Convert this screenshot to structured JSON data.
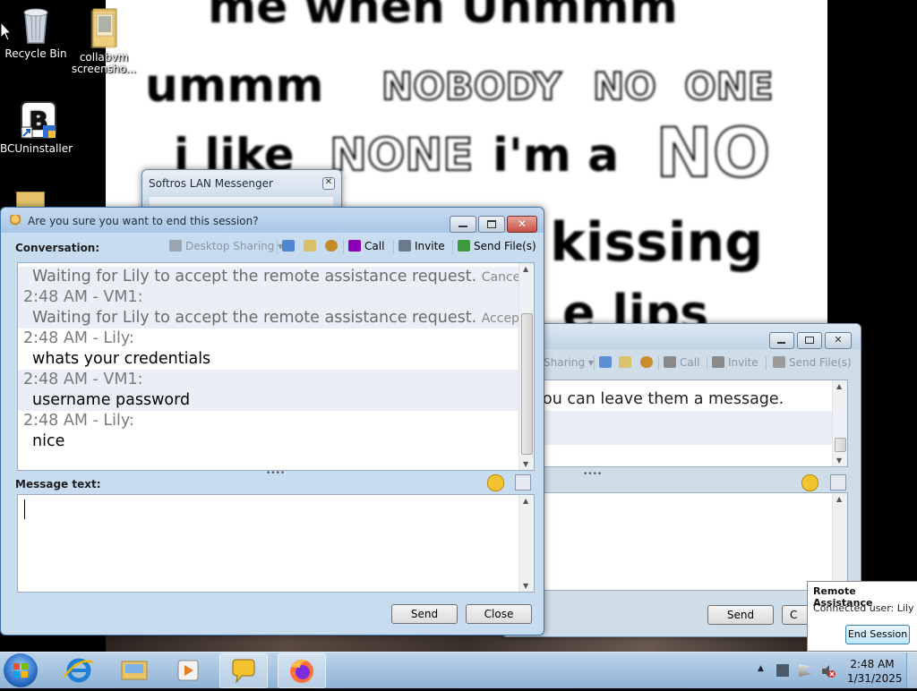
{
  "desktop": {
    "icons": [
      {
        "label": "Recycle Bin",
        "icon": "recycle-bin-icon"
      },
      {
        "label": "collabvm screensho...",
        "icon": "folder-icon"
      },
      {
        "label": "BCUninstaller",
        "icon": "bcuninstaller-icon"
      }
    ]
  },
  "wallpaper": {
    "line1": "me when Uhmmm",
    "line2a": "ummm",
    "line2b": "NOBODY",
    "line2c": "NO",
    "line2d": "ONE",
    "line3a": "i like",
    "line3b": "NONE",
    "line3c": "i'm a",
    "line3d": "NO",
    "line4": "kissing",
    "line5": "e lips"
  },
  "messenger_list": {
    "title": "Softros LAN Messenger"
  },
  "chat_front": {
    "title": "Are you sure you want to end this session?",
    "conversation_label": "Conversation:",
    "toolbar": {
      "desktop_sharing": "Desktop Sharing",
      "call": "Call",
      "invite": "Invite",
      "send_files": "Send File(s)"
    },
    "messages": [
      {
        "speaker": "",
        "text": "Waiting for Lily to accept the remote assistance request.",
        "status": "Canceled",
        "style": "grey"
      },
      {
        "speaker": "2:48 AM - VM1:",
        "text": "Waiting for Lily to accept the remote assistance request.",
        "status": "Accepted",
        "style": "grey"
      },
      {
        "speaker": "2:48 AM - Lily:",
        "text": "whats your credentials",
        "status": "",
        "style": "black"
      },
      {
        "speaker": "2:48 AM - VM1:",
        "text": "username password",
        "status": "",
        "style": "black"
      },
      {
        "speaker": "2:48 AM - Lily:",
        "text": "nice",
        "status": "",
        "style": "black"
      }
    ],
    "message_text_label": "Message text:",
    "message_input_value": "",
    "send_label": "Send",
    "close_label": "Close"
  },
  "chat_back": {
    "toolbar": {
      "sharing": "Sharing",
      "call": "Call",
      "invite": "Invite",
      "send_files": "Send File(s)"
    },
    "message_fragment": "ou can leave them a message.",
    "send_label": "Send",
    "close_label": "C"
  },
  "remote_assistance": {
    "title": "Remote Assistance",
    "connected_user": "Connected user: Lily",
    "end_session_label": "End Session"
  },
  "taskbar": {
    "time": "2:48 AM",
    "date": "1/31/2025"
  },
  "colors": {
    "accent": "#3a6ea5",
    "taskbar": "#a9c5e2",
    "video_call": "#8b00b5"
  }
}
